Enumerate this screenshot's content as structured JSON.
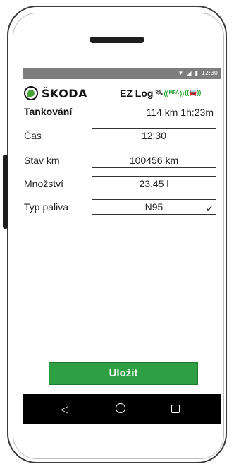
{
  "status_bar": {
    "time": "12:30",
    "icons": [
      "wifi-icon",
      "signal-icon",
      "battery-icon"
    ]
  },
  "header": {
    "brand": "ŠKODA",
    "app_name": "EZ Log",
    "mfa_label": "MFA"
  },
  "page": {
    "title": "Tankování",
    "trip_info": "114 km 1h:23m"
  },
  "form": {
    "time_label": "Čas",
    "time_value": "12:30",
    "odometer_label": "Stav km",
    "odometer_value": "100456 km",
    "amount_label": "Množství",
    "amount_value": "23.45 l",
    "fuel_label": "Typ paliva",
    "fuel_value": "N95"
  },
  "actions": {
    "save_label": "Uložit"
  },
  "colors": {
    "accent": "#2ea043",
    "statusbar": "#7d7d7d",
    "navbar": "#000000"
  }
}
